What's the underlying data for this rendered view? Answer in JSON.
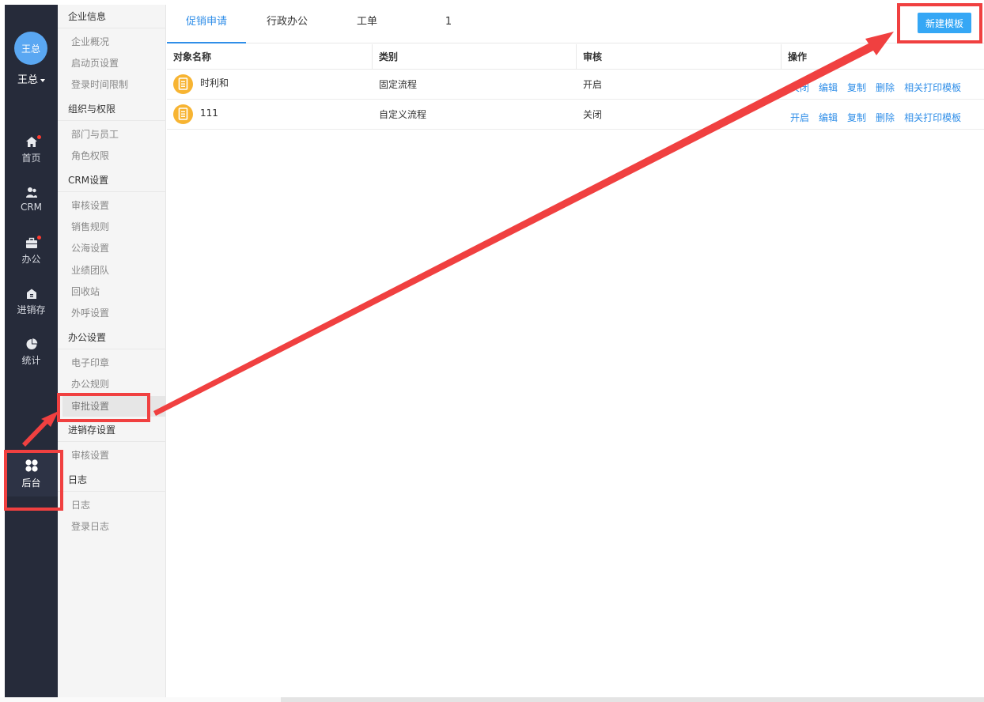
{
  "user": {
    "avatar_text": "王总",
    "name": "王总"
  },
  "nav": {
    "home": "首页",
    "crm": "CRM",
    "office": "办公",
    "inventory": "进销存",
    "stats": "统计",
    "admin": "后台"
  },
  "sidebar": {
    "g1": "企业信息",
    "i1_1": "企业概况",
    "i1_2": "启动页设置",
    "i1_3": "登录时间限制",
    "g2": "组织与权限",
    "i2_1": "部门与员工",
    "i2_2": "角色权限",
    "g3": "CRM设置",
    "i3_1": "审核设置",
    "i3_2": "销售规则",
    "i3_3": "公海设置",
    "i3_4": "业绩团队",
    "i3_5": "回收站",
    "i3_6": "外呼设置",
    "g4": "办公设置",
    "i4_1": "电子印章",
    "i4_2": "办公规则",
    "i4_3": "审批设置",
    "g5": "进销存设置",
    "i5_1": "审核设置",
    "g6": "日志",
    "i6_1": "日志",
    "i6_2": "登录日志"
  },
  "tabs": {
    "t1": "促销申请",
    "t2": "行政办公",
    "t3": "工单",
    "t4": "1"
  },
  "toolbar": {
    "new_template": "新建模板"
  },
  "table": {
    "h_name": "对象名称",
    "h_type": "类别",
    "h_review": "审核",
    "h_ops": "操作",
    "r1": {
      "name": "时利和",
      "type": "固定流程",
      "review": "开启",
      "toggle": "关闭"
    },
    "r2": {
      "name": "111",
      "type": "自定义流程",
      "review": "关闭",
      "toggle": "开启"
    },
    "a_edit": "编辑",
    "a_copy": "复制",
    "a_delete": "删除",
    "a_print": "相关打印模板"
  },
  "colors": {
    "nav_bg": "#262b3a",
    "accent": "#2f8ee8",
    "button": "#35a7f5",
    "annotation": "#f04040",
    "icon": "#f7b432"
  }
}
